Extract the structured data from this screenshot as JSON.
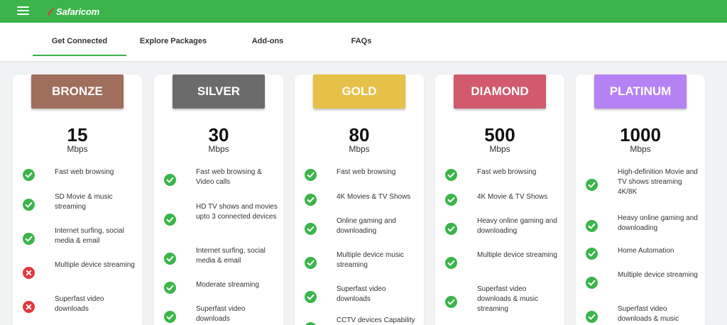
{
  "header": {
    "menu_icon": "hamburger-menu-icon",
    "logo_text": "Safaricom",
    "brand_color": "#3bb54a"
  },
  "tabs": [
    {
      "label": "Get Connected",
      "active": true
    },
    {
      "label": "Explore Packages",
      "active": false
    },
    {
      "label": "Add-ons",
      "active": false
    },
    {
      "label": "FAQs",
      "active": false
    }
  ],
  "plans": [
    {
      "name": "BRONZE",
      "color": "#a06e5c",
      "speed": "15",
      "unit": "Mbps",
      "features": [
        {
          "text": "Fast web browsing",
          "included": true
        },
        {
          "text": "SD Movie & music streaming",
          "included": true
        },
        {
          "text": "Internet surfing, social media & email",
          "included": true
        },
        {
          "text": "Multiple device streaming",
          "included": false
        },
        {
          "text": "Superfast video downloads",
          "included": false
        }
      ]
    },
    {
      "name": "SILVER",
      "color": "#6b6b6b",
      "speed": "30",
      "unit": "Mbps",
      "features": [
        {
          "text": "Fast web browsing & Video calls",
          "included": true
        },
        {
          "text": "HD TV shows and movies upto 3 connected devices",
          "included": true
        },
        {
          "text": "Internet surfing, social media & email",
          "included": true
        },
        {
          "text": "Moderate streaming",
          "included": true
        },
        {
          "text": "Superfast video downloads",
          "included": true
        }
      ]
    },
    {
      "name": "GOLD",
      "color": "#e7c04a",
      "speed": "80",
      "unit": "Mbps",
      "features": [
        {
          "text": "Fast web browsing",
          "included": true
        },
        {
          "text": "4K Movies & TV Shows",
          "included": true
        },
        {
          "text": "Online gaming and downloading",
          "included": true
        },
        {
          "text": "Multiple device music streaming",
          "included": true
        },
        {
          "text": "Superfast video downloads",
          "included": true
        },
        {
          "text": "CCTV devices Capability",
          "included": true
        }
      ]
    },
    {
      "name": "DIAMOND",
      "color": "#d15a6c",
      "speed": "500",
      "unit": "Mbps",
      "features": [
        {
          "text": "Fast web browsing",
          "included": true
        },
        {
          "text": "4K Movie & TV Shows",
          "included": true
        },
        {
          "text": "Heavy online gaming and downloading",
          "included": true
        },
        {
          "text": "Multiple device streaming",
          "included": true
        },
        {
          "text": "Superfast video downloads & music streaming",
          "included": true
        }
      ]
    },
    {
      "name": "PLATINUM",
      "color": "#b482f2",
      "speed": "1000",
      "unit": "Mbps",
      "features": [
        {
          "text": "High-definition Movie and TV shows streaming 4K/8K",
          "included": true
        },
        {
          "text": "Heavy online gaming and downloading",
          "included": true
        },
        {
          "text": "Home Automation",
          "included": true
        },
        {
          "text": "Multiple device streaming",
          "included": true
        },
        {
          "text": "Superfast video downloads & music",
          "included": true
        }
      ]
    }
  ],
  "icons": {
    "included": "check-circle-icon",
    "excluded": "x-circle-icon",
    "check_color": "#3bb54a",
    "x_color": "#e0393e"
  }
}
